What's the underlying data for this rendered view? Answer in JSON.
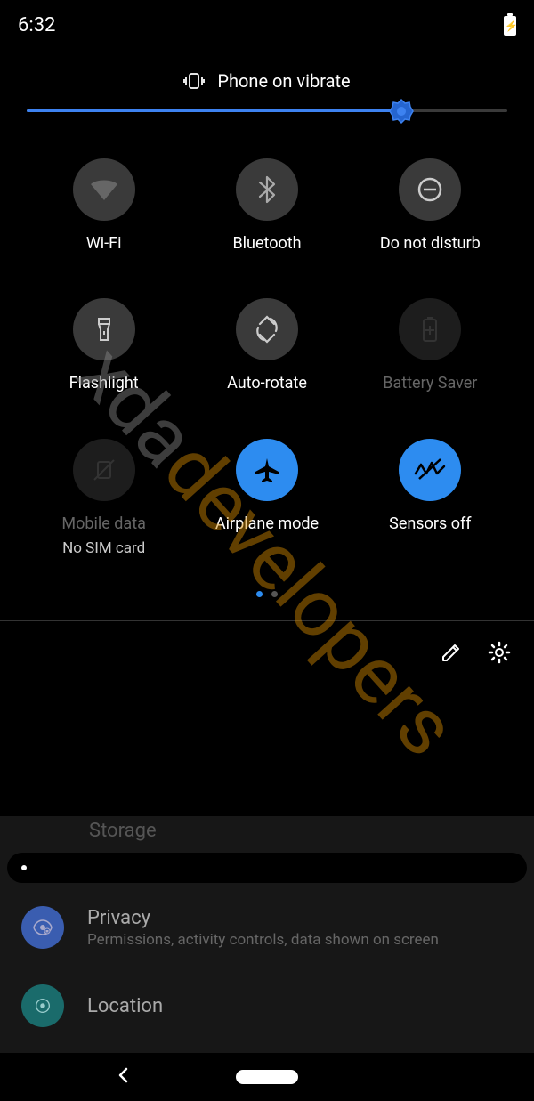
{
  "statusBar": {
    "time": "6:32"
  },
  "vibrate": {
    "label": "Phone on vibrate"
  },
  "brightness": {
    "percent": 78
  },
  "tiles": [
    {
      "id": "wifi",
      "label": "Wi-Fi",
      "state": "off"
    },
    {
      "id": "bluetooth",
      "label": "Bluetooth",
      "state": "off"
    },
    {
      "id": "dnd",
      "label": "Do not disturb",
      "state": "off"
    },
    {
      "id": "flashlight",
      "label": "Flashlight",
      "state": "off"
    },
    {
      "id": "autorotate",
      "label": "Auto-rotate",
      "state": "off"
    },
    {
      "id": "batterysaver",
      "label": "Battery Saver",
      "state": "disabled"
    },
    {
      "id": "mobiledata",
      "label": "Mobile data",
      "sublabel": "No SIM card",
      "state": "disabled"
    },
    {
      "id": "airplane",
      "label": "Airplane mode",
      "state": "on"
    },
    {
      "id": "sensors",
      "label": "Sensors off",
      "state": "on"
    }
  ],
  "pageIndicator": {
    "current": 0,
    "total": 2
  },
  "background": {
    "peekRow": "Storage",
    "items": [
      {
        "title": "Privacy",
        "subtitle": "Permissions, activity controls, data shown on screen"
      },
      {
        "title": "Location",
        "subtitle": ""
      }
    ]
  },
  "watermark": {
    "part1": "xda",
    "part2": "developers"
  }
}
